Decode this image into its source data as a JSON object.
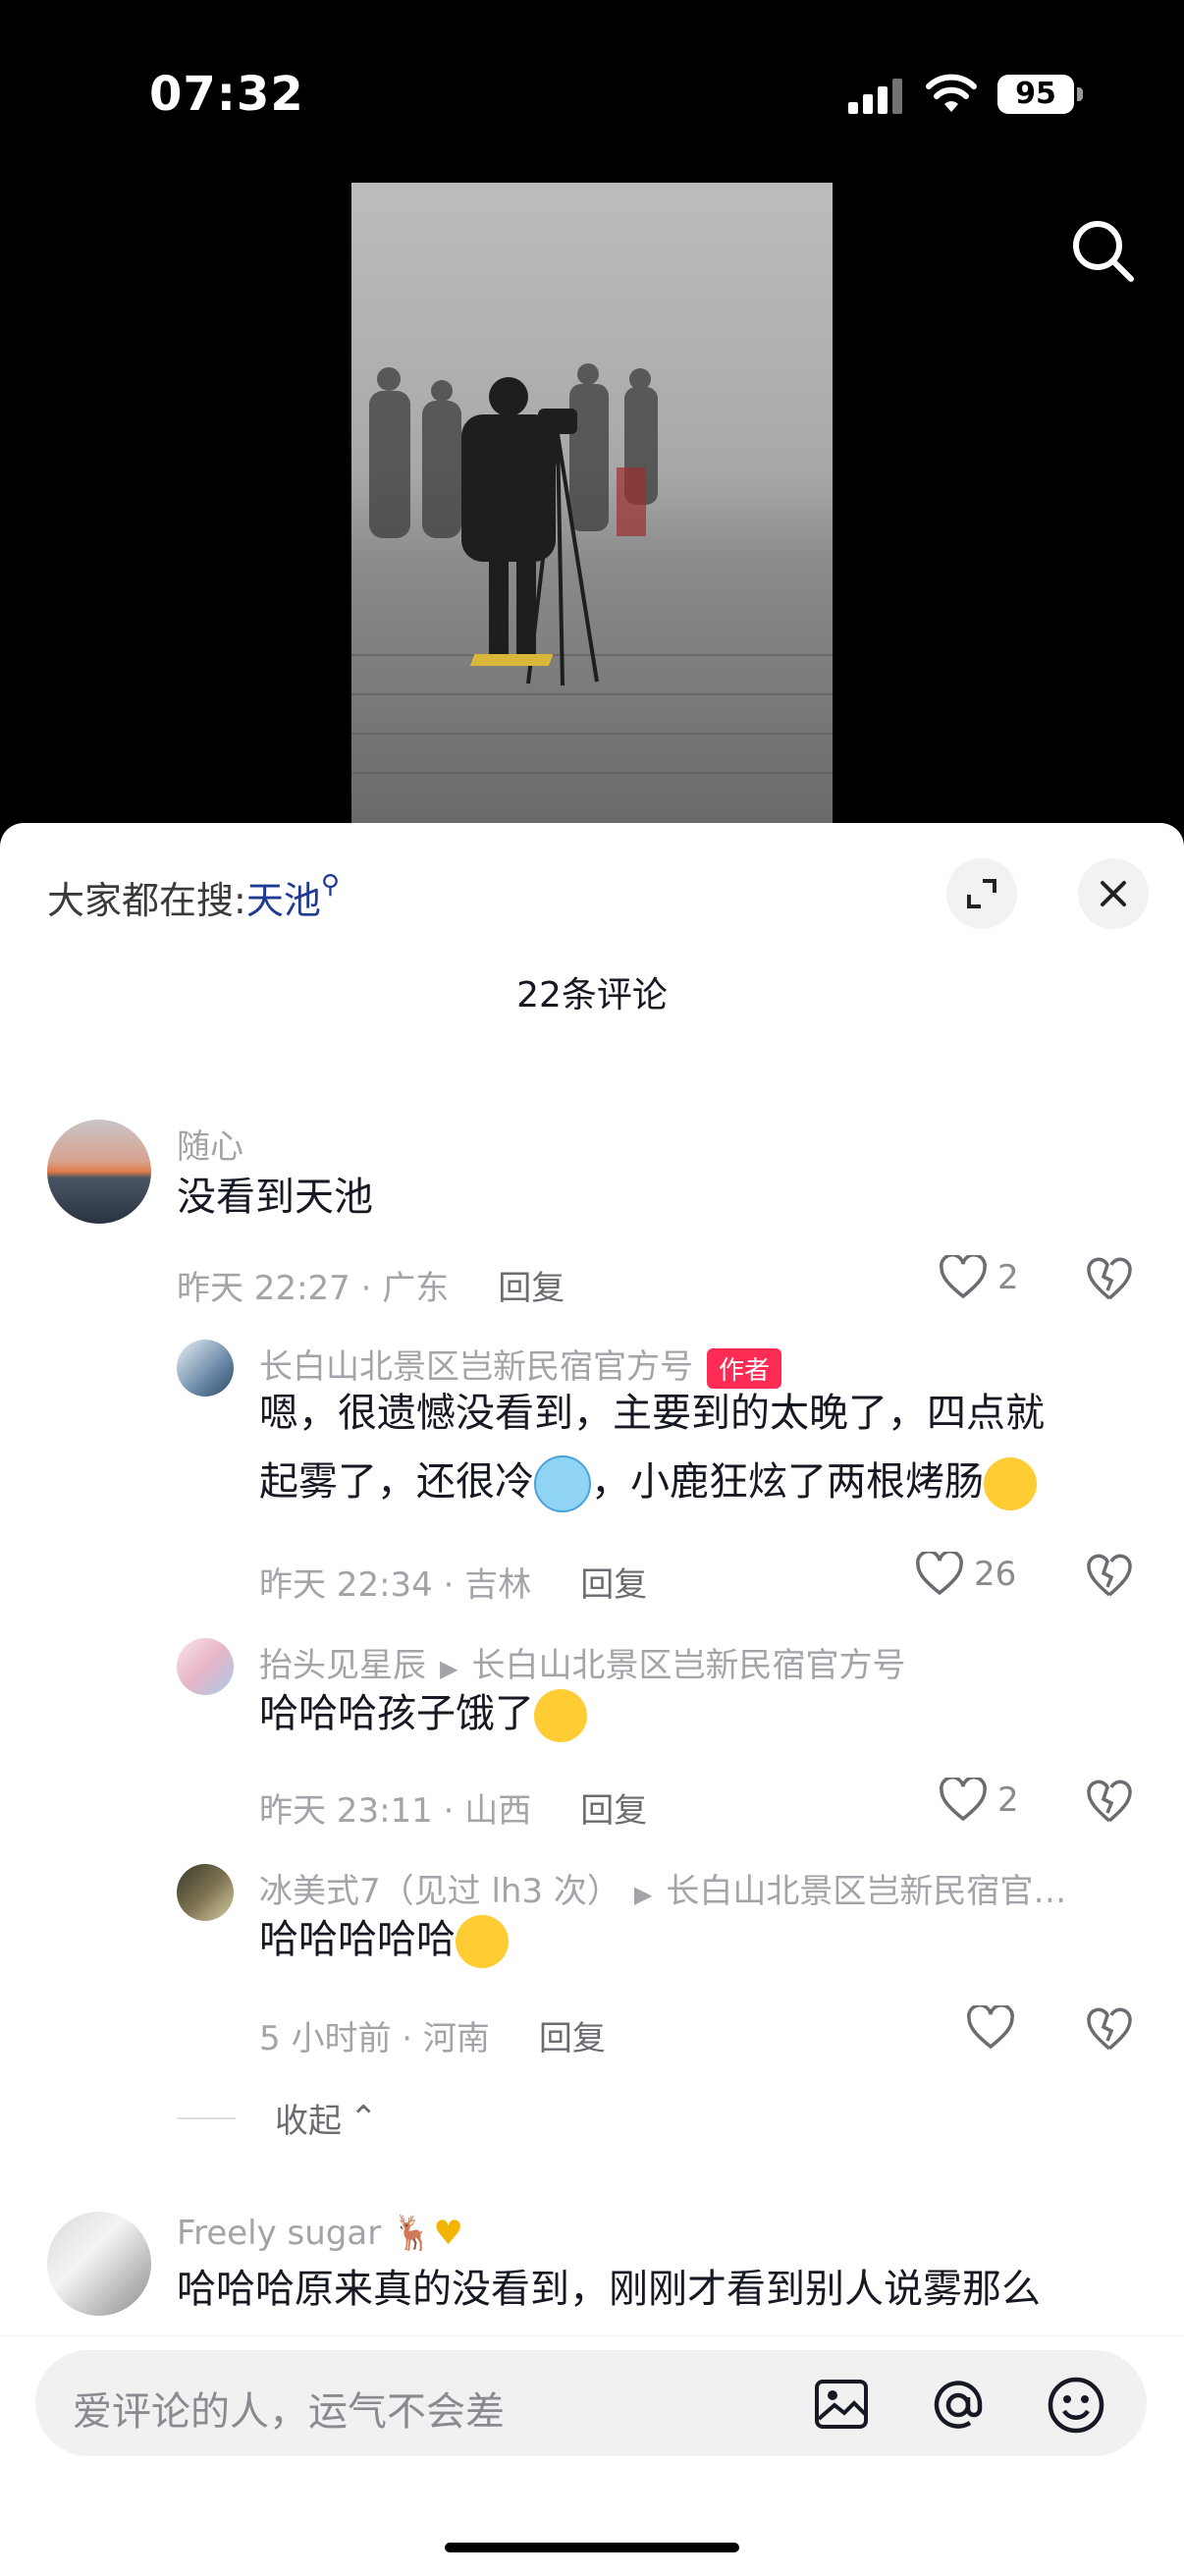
{
  "status": {
    "time": "07:32",
    "battery": "95"
  },
  "video": {
    "scene": "foggy-mountain-video-frame"
  },
  "sheet": {
    "hot_search_prefix": "大家都在搜:",
    "hot_search_keyword": "天池",
    "comment_count_title": "22条评论"
  },
  "comments": [
    {
      "user": "随心",
      "text": "没看到天池",
      "time": "昨天 22:27 · 广东",
      "reply": "回复",
      "likes": "2"
    },
    {
      "user": "长白山北景区岂新民宿官方号",
      "author_tag": "作者",
      "text_line1": "嗯，很遗憾没看到，主要到的太晚了，四点就",
      "text_line2a": "起雾了，还很冷",
      "text_line2b": "，小鹿狂炫了两根烤肠",
      "time": "昨天 22:34 · 吉林",
      "reply": "回复",
      "likes": "26"
    },
    {
      "user": "抬头见星辰",
      "reply_to": "长白山北景区岂新民宿官方号",
      "text": "哈哈哈孩子饿了",
      "time": "昨天 23:11 · 山西",
      "reply": "回复",
      "likes": "2"
    },
    {
      "user": "冰美式7（见过 lh3 次）",
      "reply_to": "长白山北景区岂新民宿官…",
      "text": "哈哈哈哈哈",
      "time": "5 小时前 · 河南",
      "reply": "回复",
      "likes": ""
    },
    {
      "user": "Freely sugar",
      "text": "哈哈哈原来真的没看到，刚刚才看到别人说雾那么"
    }
  ],
  "collapse_label": "收起",
  "input": {
    "placeholder": "爱评论的人，运气不会差"
  },
  "icons": {
    "search": "search-icon",
    "expand": "expand-icon",
    "close": "close-icon",
    "heart": "heart-icon",
    "dislike": "broken-heart-icon",
    "image": "image-icon",
    "at": "at-icon",
    "emoji": "emoji-icon"
  }
}
